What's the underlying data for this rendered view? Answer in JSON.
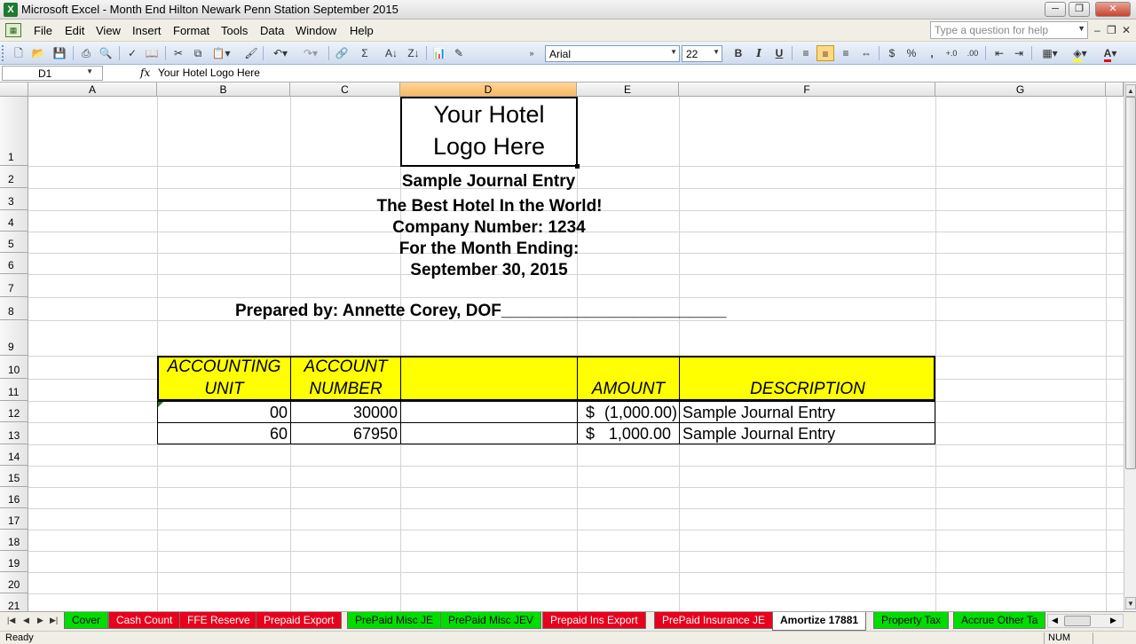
{
  "window": {
    "app_icon": "X",
    "title": "Microsoft Excel - Month End Hilton Newark Penn Station September 2015",
    "minimize": "─",
    "restore": "❐",
    "close": "✕"
  },
  "menu": {
    "items": [
      "File",
      "Edit",
      "View",
      "Insert",
      "Format",
      "Tools",
      "Data",
      "Window",
      "Help"
    ],
    "help_placeholder": "Type a question for help"
  },
  "toolbar": {
    "font_name": "Arial",
    "font_size": "22",
    "bold": "B",
    "italic": "I",
    "underline": "U",
    "currency": "$",
    "percent": "%",
    "comma": ",",
    "sum": "Σ",
    "sort_asc": "A↓",
    "sort_desc": "Z↓"
  },
  "formula_bar": {
    "name_box": "D1",
    "fx": "fx",
    "content": "Your Hotel Logo Here"
  },
  "columns": [
    "A",
    "B",
    "C",
    "D",
    "E",
    "F",
    "G"
  ],
  "selected_column": "D",
  "rows": [
    "1",
    "2",
    "3",
    "4",
    "5",
    "6",
    "7",
    "8",
    "9",
    "10",
    "11",
    "12",
    "13",
    "14",
    "15",
    "16",
    "17",
    "18",
    "19",
    "20",
    "21"
  ],
  "sheet": {
    "logo_line1": "Your Hotel",
    "logo_line2": "Logo Here",
    "title": "Sample Journal Entry",
    "subtitle": "The Best Hotel In the World!",
    "company": "Company Number: 1234",
    "month_label": "For the Month Ending:",
    "month_date": "September 30, 2015",
    "prepared_by": "Prepared by: Annette Corey, DOF________________________",
    "headers": {
      "accounting_unit_1": "ACCOUNTING",
      "accounting_unit_2": "UNIT",
      "account_number_1": "ACCOUNT",
      "account_number_2": "NUMBER",
      "amount": "AMOUNT",
      "description": "DESCRIPTION"
    },
    "entries": [
      {
        "unit": "00",
        "account": "30000",
        "currency": "$",
        "amount": "(1,000.00)",
        "description": "Sample Journal Entry"
      },
      {
        "unit": "60",
        "account": "67950",
        "currency": "$",
        "amount": "1,000.00",
        "description": "Sample Journal Entry"
      }
    ]
  },
  "sheet_tabs": [
    {
      "label": "Cover",
      "color": "green"
    },
    {
      "label": "Cash Count",
      "color": "red"
    },
    {
      "label": "FFE Reserve",
      "color": "red"
    },
    {
      "label": "Prepaid Export",
      "color": "red"
    },
    {
      "label": "PrePaid Misc JE",
      "color": "green"
    },
    {
      "label": "PrePaid Misc JEV",
      "color": "green"
    },
    {
      "label": "Prepaid Ins Export",
      "color": "red"
    },
    {
      "label": "PrePaid Insurance JE",
      "color": "red"
    },
    {
      "label": "Amortize 17881",
      "color": "active"
    },
    {
      "label": "Property Tax",
      "color": "green"
    },
    {
      "label": "Accrue Other Ta",
      "color": "green"
    }
  ],
  "status": {
    "ready": "Ready",
    "num": "NUM"
  },
  "colors": {
    "header_fill": "#ffff00",
    "tab_green": "#00dd00",
    "tab_red": "#e8001c",
    "selected_header": "#f7b863"
  }
}
